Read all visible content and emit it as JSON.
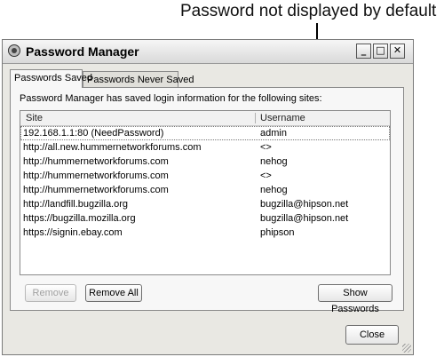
{
  "annotation": {
    "text": "Password not displayed by default"
  },
  "window": {
    "title": "Password Manager",
    "title_buttons": {
      "minimize": "_",
      "maximize": "□",
      "close": "✕"
    }
  },
  "tabs": [
    {
      "label": "Passwords Saved",
      "active": true
    },
    {
      "label": "Passwords Never Saved",
      "active": false
    }
  ],
  "panel": {
    "description": "Password Manager has saved login information for the following sites:"
  },
  "table": {
    "columns": [
      "Site",
      "Username"
    ],
    "rows": [
      {
        "site": "192.168.1.1:80 (NeedPassword)",
        "username": "admin"
      },
      {
        "site": "http://all.new.hummernetworkforums.com",
        "username": "<>"
      },
      {
        "site": "http://hummernetworkforums.com",
        "username": "nehog"
      },
      {
        "site": "http://hummernetworkforums.com",
        "username": "<>"
      },
      {
        "site": "http://hummernetworkforums.com",
        "username": "nehog"
      },
      {
        "site": "http://landfill.bugzilla.org",
        "username": "bugzilla@hipson.net"
      },
      {
        "site": "https://bugzilla.mozilla.org",
        "username": "bugzilla@hipson.net"
      },
      {
        "site": "https://signin.ebay.com",
        "username": "phipson"
      }
    ]
  },
  "buttons": {
    "remove": "Remove",
    "remove_all": "Remove All",
    "show_passwords": "Show Passwords",
    "close": "Close"
  }
}
